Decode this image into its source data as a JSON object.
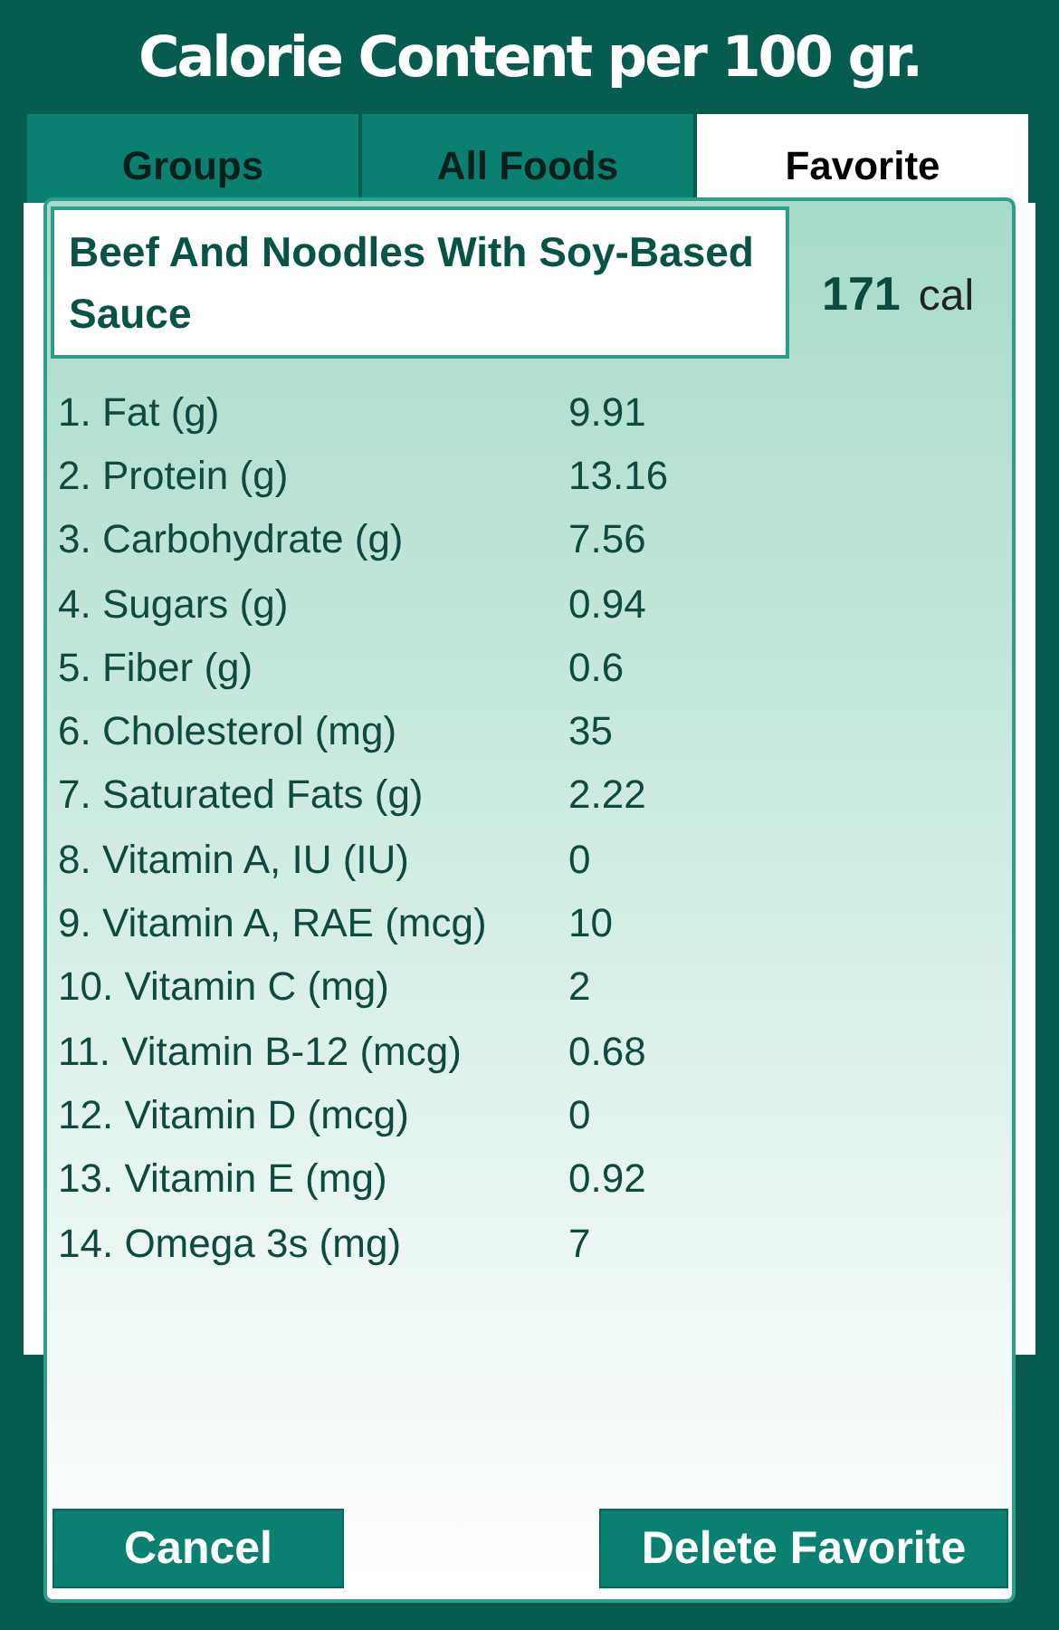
{
  "title": "Calorie Content per 100 gr.",
  "tabs": [
    {
      "label": "Groups",
      "selected": false
    },
    {
      "label": "All Foods",
      "selected": false
    },
    {
      "label": "Favorite",
      "selected": true
    }
  ],
  "dialog": {
    "food_name": "Beef And Noodles With Soy-Based Sauce",
    "calories": "171",
    "calories_unit": "cal",
    "nutrients": [
      {
        "label": "1. Fat (g)",
        "value": "9.91"
      },
      {
        "label": "2. Protein (g)",
        "value": "13.16"
      },
      {
        "label": "3. Carbohydrate (g)",
        "value": "7.56"
      },
      {
        "label": "4. Sugars (g)",
        "value": "0.94"
      },
      {
        "label": "5. Fiber (g)",
        "value": "0.6"
      },
      {
        "label": "6. Cholesterol (mg)",
        "value": "35"
      },
      {
        "label": "7. Saturated Fats (g)",
        "value": "2.22"
      },
      {
        "label": "8. Vitamin A, IU (IU)",
        "value": "0"
      },
      {
        "label": "9. Vitamin A, RAE (mcg)",
        "value": "10"
      },
      {
        "label": "10. Vitamin C (mg)",
        "value": "2"
      },
      {
        "label": "11. Vitamin B-12 (mcg)",
        "value": "0.68"
      },
      {
        "label": "12. Vitamin D (mcg)",
        "value": "0"
      },
      {
        "label": "13. Vitamin E (mg)",
        "value": "0.92"
      },
      {
        "label": "14. Omega 3s (mg)",
        "value": "7"
      }
    ],
    "buttons": [
      {
        "label": "Cancel"
      },
      {
        "label": "Delete Favorite"
      }
    ]
  }
}
